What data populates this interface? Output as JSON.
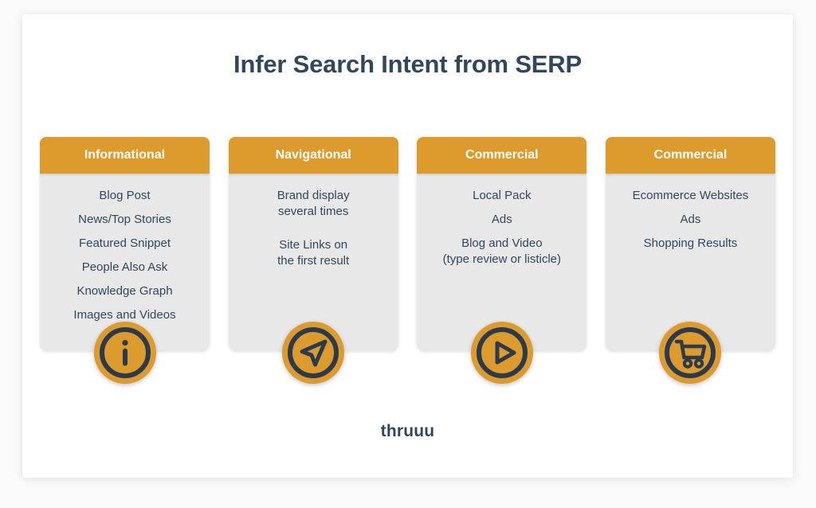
{
  "page": {
    "title": "Infer Search Intent from SERP",
    "brand": "thruuu"
  },
  "theme": {
    "accent_orange": "#dd9a2d",
    "text_navy": "#33475b",
    "card_body_bg": "#e8e8e8",
    "canvas_bg": "#ffffff",
    "page_bg": "#fbfbfb",
    "header_text": "#ffffff"
  },
  "cards": [
    {
      "title": "Informational",
      "icon": "info-icon",
      "items": [
        {
          "line1": "Blog Post",
          "line2": "",
          "spaced": false
        },
        {
          "line1": "News/Top Stories",
          "line2": "",
          "spaced": false
        },
        {
          "line1": "Featured Snippet",
          "line2": "",
          "spaced": false
        },
        {
          "line1": "People Also Ask",
          "line2": "",
          "spaced": false
        },
        {
          "line1": "Knowledge Graph",
          "line2": "",
          "spaced": false
        },
        {
          "line1": "Images and Videos",
          "line2": "",
          "spaced": false
        }
      ]
    },
    {
      "title": "Navigational",
      "icon": "navigation-arrow-icon",
      "items": [
        {
          "line1": "Brand display",
          "line2": "several times",
          "spaced": true
        },
        {
          "line1": "Site Links on",
          "line2": "the first result",
          "spaced": false
        }
      ]
    },
    {
      "title": "Commercial",
      "icon": "play-icon",
      "items": [
        {
          "line1": "Local Pack",
          "line2": "",
          "spaced": false
        },
        {
          "line1": "Ads",
          "line2": "",
          "spaced": false
        },
        {
          "line1": "Blog and Video",
          "line2": "(type review or listicle)",
          "spaced": false
        }
      ]
    },
    {
      "title": "Commercial",
      "icon": "shopping-cart-icon",
      "items": [
        {
          "line1": "Ecommerce Websites",
          "line2": "",
          "spaced": false
        },
        {
          "line1": "Ads",
          "line2": "",
          "spaced": false
        },
        {
          "line1": "Shopping Results",
          "line2": "",
          "spaced": false
        }
      ]
    }
  ]
}
